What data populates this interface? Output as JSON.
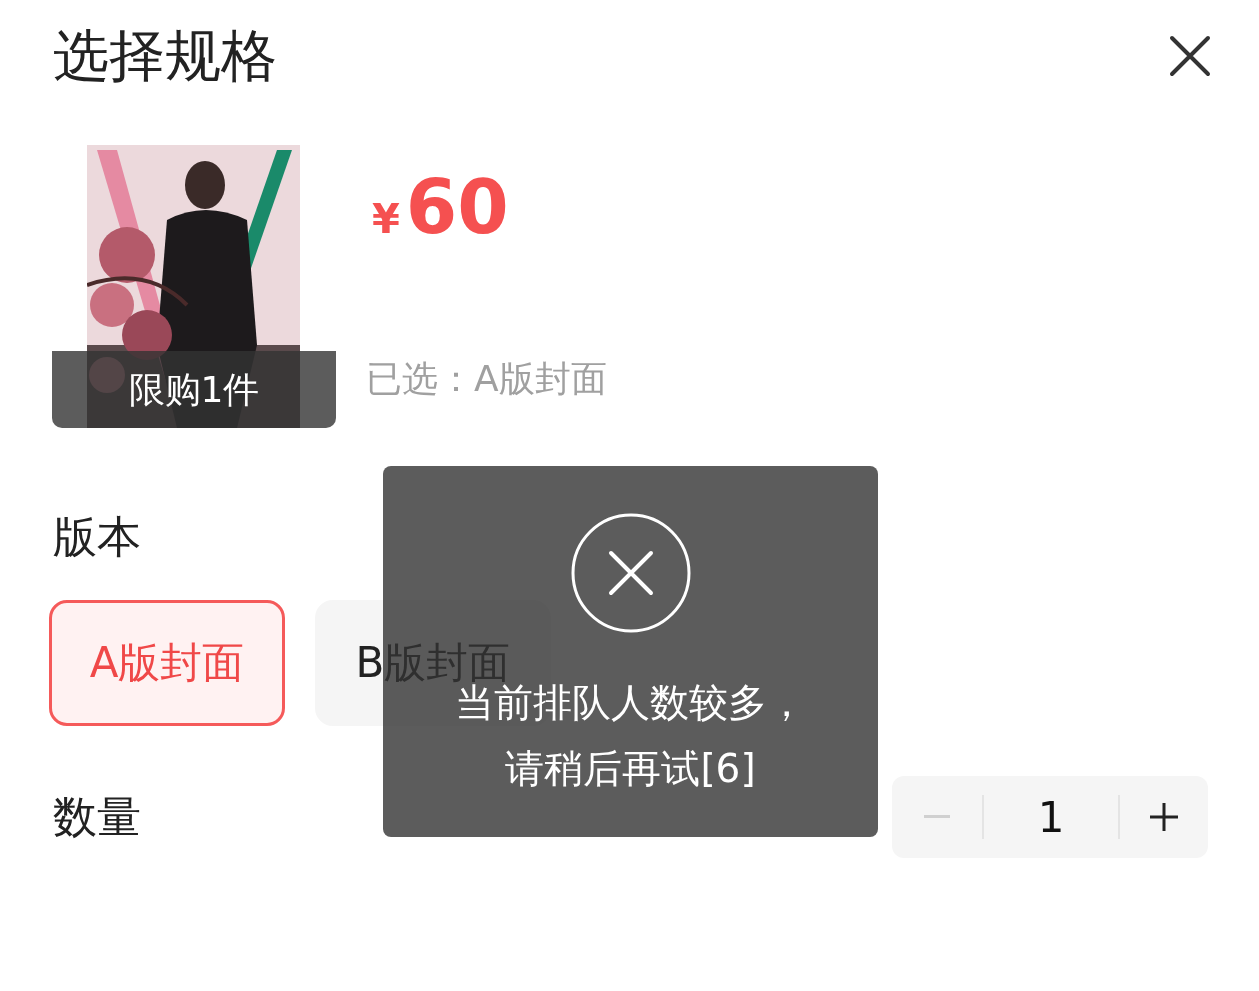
{
  "header": {
    "title": "选择规格"
  },
  "product": {
    "limit_badge": "限购1件",
    "currency": "¥",
    "price": "60",
    "selected_summary": "已选：A版封面"
  },
  "version": {
    "label": "版本",
    "options": [
      {
        "label": "A版封面",
        "selected": true
      },
      {
        "label": "B版封面",
        "selected": false
      }
    ]
  },
  "quantity": {
    "label": "数量",
    "value": "1",
    "decrement_disabled": true
  },
  "toast": {
    "lines": [
      "当前排队人数较多，",
      "请稍后再试[6]"
    ]
  }
}
